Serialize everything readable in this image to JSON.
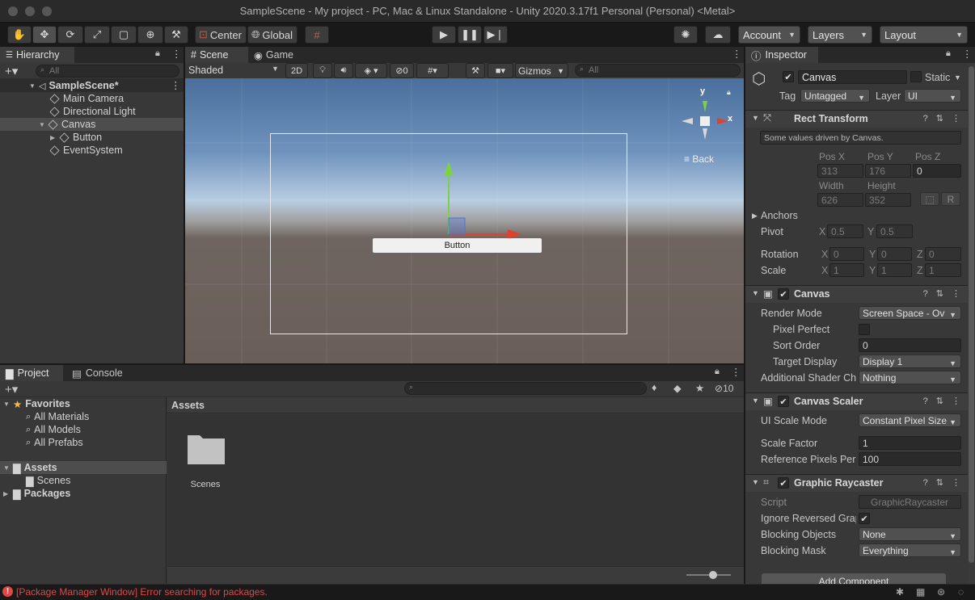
{
  "window": {
    "title": "SampleScene - My project - PC, Mac & Linux Standalone - Unity 2020.3.17f1 Personal (Personal) <Metal>"
  },
  "toolbar": {
    "tools": [
      "hand-tool",
      "move-tool",
      "rotate-tool",
      "scale-tool",
      "rect-tool",
      "transform-tool",
      "custom-tool"
    ],
    "pivot_mode": "Center",
    "pivot_rotation": "Global",
    "account": "Account",
    "layers": "Layers",
    "layout": "Layout"
  },
  "hierarchy": {
    "tab": "Hierarchy",
    "search_placeholder": "All",
    "scene": "SampleScene*",
    "items": [
      "Main Camera",
      "Directional Light",
      "Canvas",
      "Button",
      "EventSystem"
    ]
  },
  "scene_view": {
    "tabs": [
      "Scene",
      "Game"
    ],
    "shading": "Shaded",
    "mode_2d": "2D",
    "hidden_count": "0",
    "gizmos": "Gizmos",
    "search_placeholder": "All",
    "gizmo_labels": {
      "y": "y",
      "x": "x",
      "back": "Back"
    },
    "button_label": "Button"
  },
  "project": {
    "tabs": [
      "Project",
      "Console"
    ],
    "hidden_count": "10",
    "favorites_label": "Favorites",
    "favorites": [
      "All Materials",
      "All Models",
      "All Prefabs"
    ],
    "assets_label": "Assets",
    "assets_children": [
      "Scenes"
    ],
    "packages_label": "Packages",
    "breadcrumb": "Assets",
    "files": [
      {
        "name": "Scenes",
        "type": "folder"
      }
    ],
    "zoom": 0.6
  },
  "inspector": {
    "tab": "Inspector",
    "object_name": "Canvas",
    "static_label": "Static",
    "tag_label": "Tag",
    "tag_value": "Untagged",
    "layer_label": "Layer",
    "layer_value": "UI",
    "rect_transform": {
      "title": "Rect Transform",
      "note": "Some values driven by Canvas.",
      "posx_label": "Pos X",
      "posy_label": "Pos Y",
      "posz_label": "Pos Z",
      "posx": "313",
      "posy": "176",
      "posz": "0",
      "width_label": "Width",
      "height_label": "Height",
      "width": "626",
      "height": "352",
      "anchors_label": "Anchors",
      "pivot_label": "Pivot",
      "pivot_x": "0.5",
      "pivot_y": "0.5",
      "rotation_label": "Rotation",
      "rot_x": "0",
      "rot_y": "0",
      "rot_z": "0",
      "scale_label": "Scale",
      "scale_x": "1",
      "scale_y": "1",
      "scale_z": "1",
      "x": "X",
      "y": "Y",
      "z": "Z",
      "r_btn": "R"
    },
    "canvas": {
      "title": "Canvas",
      "render_mode_label": "Render Mode",
      "render_mode": "Screen Space - Ov",
      "pixel_perfect_label": "Pixel Perfect",
      "sort_order_label": "Sort Order",
      "sort_order": "0",
      "target_display_label": "Target Display",
      "target_display": "Display 1",
      "shader_ch_label": "Additional Shader Ch",
      "shader_ch": "Nothing"
    },
    "canvas_scaler": {
      "title": "Canvas Scaler",
      "scale_mode_label": "UI Scale Mode",
      "scale_mode": "Constant Pixel Size",
      "scale_factor_label": "Scale Factor",
      "scale_factor": "1",
      "ref_pixels_label": "Reference Pixels Per",
      "ref_pixels": "100"
    },
    "graphic_raycaster": {
      "title": "Graphic Raycaster",
      "script_label": "Script",
      "script": "GraphicRaycaster",
      "ignore_label": "Ignore Reversed Grap",
      "blocking_objects_label": "Blocking Objects",
      "blocking_objects": "None",
      "blocking_mask_label": "Blocking Mask",
      "blocking_mask": "Everything"
    },
    "add_component": "Add Component"
  },
  "status": {
    "message": "[Package Manager Window] Error searching for packages."
  },
  "colors": {
    "accent_blue": "#3a72b0",
    "error_red": "#e04848",
    "axis_green": "#7ed04a",
    "axis_red": "#e0402c"
  }
}
